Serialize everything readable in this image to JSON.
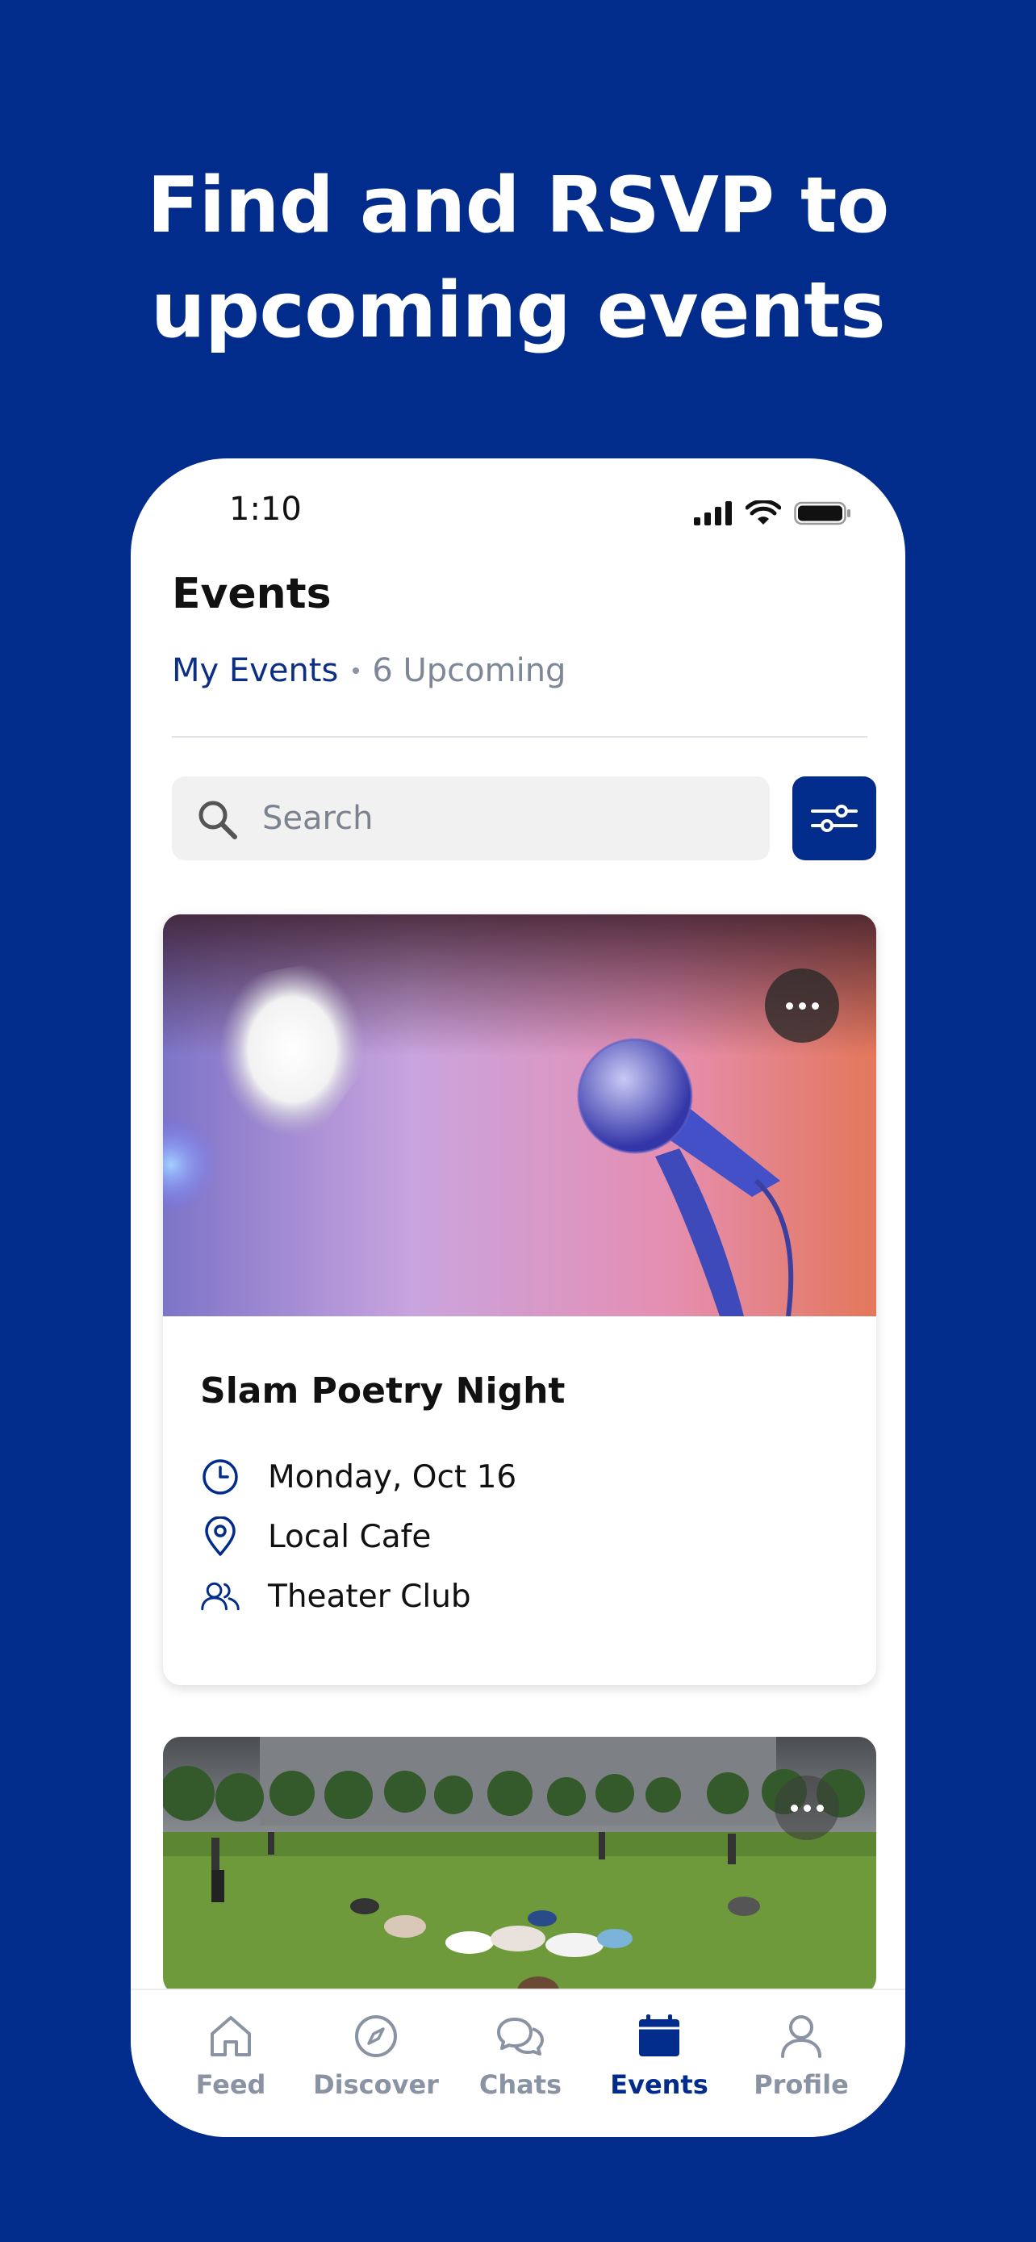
{
  "headline": {
    "line1": "Find and RSVP to",
    "line2": "upcoming events"
  },
  "status_bar": {
    "time": "1:10"
  },
  "page": {
    "title": "Events",
    "subnav_primary": "My Events",
    "subnav_secondary": "6 Upcoming"
  },
  "search": {
    "placeholder": "Search",
    "value": ""
  },
  "events": [
    {
      "title": "Slam Poetry Night",
      "date": "Monday, Oct 16",
      "location": "Local Cafe",
      "group": "Theater Club"
    }
  ],
  "tabs": [
    {
      "label": "Feed",
      "icon": "home-icon"
    },
    {
      "label": "Discover",
      "icon": "compass-icon"
    },
    {
      "label": "Chats",
      "icon": "chat-bubbles-icon"
    },
    {
      "label": "Events",
      "icon": "calendar-icon",
      "active": true
    },
    {
      "label": "Profile",
      "icon": "person-icon"
    }
  ],
  "colors": {
    "brand": "#022c8b",
    "text": "#111111",
    "muted": "#7d8797",
    "inactive_tab": "#8a93a3",
    "search_bg": "#f1f1f1"
  }
}
